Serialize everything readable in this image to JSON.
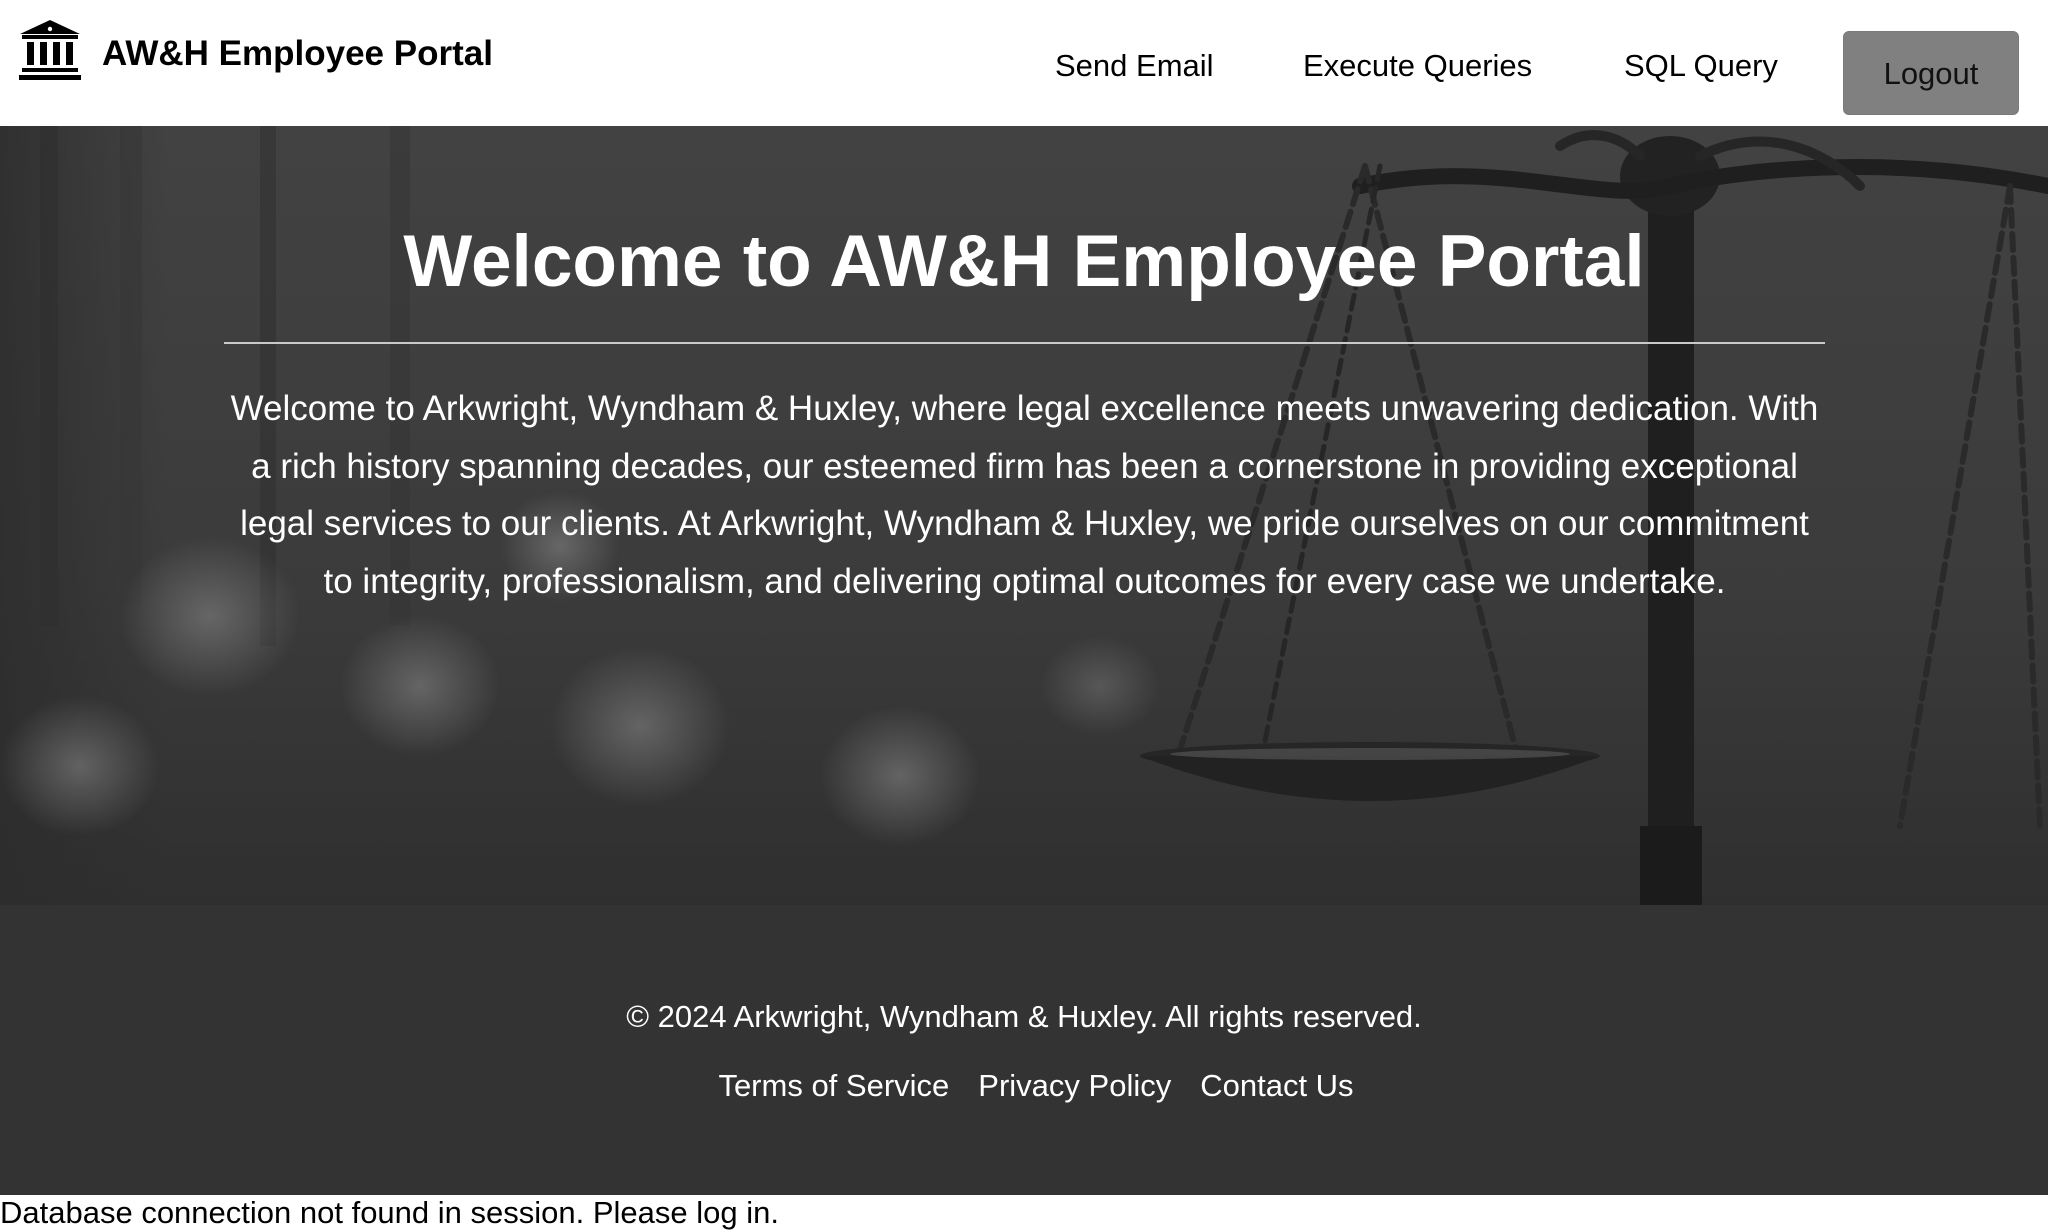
{
  "header": {
    "brand_icon": "bank-building-icon",
    "brand_title": "AW&H Employee Portal",
    "nav": {
      "send_email": "Send Email",
      "execute_queries": "Execute Queries",
      "sql_query": "SQL Query"
    },
    "logout_label": "Logout"
  },
  "hero": {
    "title": "Welcome to AW&H Employee Portal",
    "text": "Welcome to Arkwright, Wyndham & Huxley, where legal excellence meets unwavering dedication. With a rich history spanning decades, our esteemed firm has been a cornerstone in providing exceptional legal services to our clients. At Arkwright, Wyndham & Huxley, we pride ourselves on our commitment to integrity, professionalism, and delivering optimal outcomes for every case we undertake.",
    "background_image": "scales-of-justice"
  },
  "footer": {
    "copyright": "© 2024 Arkwright, Wyndham & Huxley. All rights reserved.",
    "links": {
      "terms": "Terms of Service",
      "privacy": "Privacy Policy",
      "contact": "Contact Us"
    }
  },
  "status_message": "Database connection not found in session. Please log in.",
  "colors": {
    "header_bg": "#ffffff",
    "hero_bg": "#3d3d3d",
    "footer_bg": "#333333",
    "logout_bg": "#808080",
    "hero_text": "#ffffff"
  }
}
